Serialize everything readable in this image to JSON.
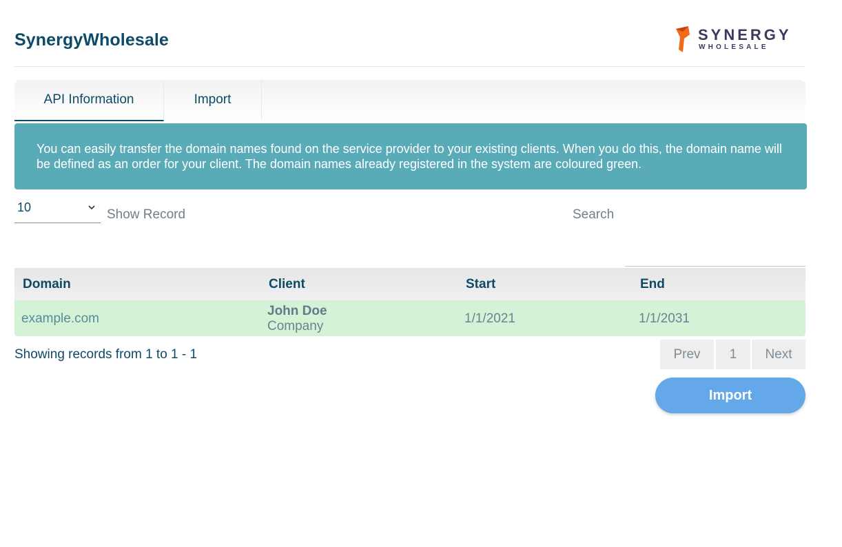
{
  "header": {
    "title": "SynergyWholesale",
    "logo": {
      "word": "SYNERGY",
      "sub": "WHOLESALE",
      "icon": "synergy-logo-mark"
    }
  },
  "tabs": [
    {
      "label": "API Information",
      "active": true
    },
    {
      "label": "Import",
      "active": false
    }
  ],
  "alert": {
    "text": "You can easily transfer the domain names found on the service provider to your existing clients. When you do this, the domain name will be defined as an order for your client. The domain names already registered in the system are coloured green."
  },
  "controls": {
    "page_size": "10",
    "show_record_label": "Show Record",
    "search_label": "Search",
    "search_value": ""
  },
  "table": {
    "columns": [
      "Domain",
      "Client",
      "Start",
      "End"
    ],
    "rows": [
      {
        "domain": "example.com",
        "client_name": "John Doe",
        "client_company": "Company",
        "start": "1/1/2021",
        "end": "1/1/2031",
        "registered": true
      }
    ]
  },
  "footer": {
    "showing": "Showing records from 1 to 1 - 1",
    "pagination": {
      "prev": "Prev",
      "current": "1",
      "next": "Next"
    },
    "import_button": "Import"
  },
  "colors": {
    "primary_text": "#0d4a66",
    "alert_bg": "#5aabb8",
    "registered_row": "#d4f3d6",
    "button": "#64a8ea",
    "logo_orange": "#f26a1b"
  }
}
